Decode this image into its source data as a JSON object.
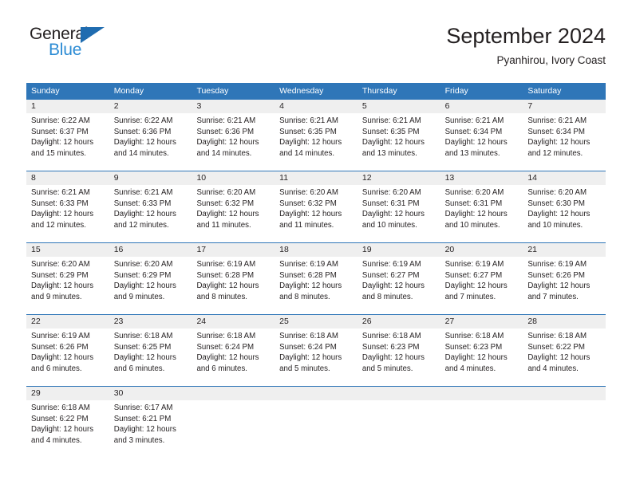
{
  "brand": {
    "name_top": "General",
    "name_bottom": "Blue",
    "accent_color": "#2b8bd4",
    "triangle_color": "#1f6cb0"
  },
  "header": {
    "title": "September 2024",
    "subtitle": "Pyanhirou, Ivory Coast"
  },
  "theme": {
    "header_blue": "#2f76b8",
    "daynum_band": "#efefef",
    "text": "#231f20"
  },
  "weekdays": [
    "Sunday",
    "Monday",
    "Tuesday",
    "Wednesday",
    "Thursday",
    "Friday",
    "Saturday"
  ],
  "weeks": [
    [
      {
        "day": "1",
        "sunrise": "Sunrise: 6:22 AM",
        "sunset": "Sunset: 6:37 PM",
        "daylight1": "Daylight: 12 hours",
        "daylight2": "and 15 minutes."
      },
      {
        "day": "2",
        "sunrise": "Sunrise: 6:22 AM",
        "sunset": "Sunset: 6:36 PM",
        "daylight1": "Daylight: 12 hours",
        "daylight2": "and 14 minutes."
      },
      {
        "day": "3",
        "sunrise": "Sunrise: 6:21 AM",
        "sunset": "Sunset: 6:36 PM",
        "daylight1": "Daylight: 12 hours",
        "daylight2": "and 14 minutes."
      },
      {
        "day": "4",
        "sunrise": "Sunrise: 6:21 AM",
        "sunset": "Sunset: 6:35 PM",
        "daylight1": "Daylight: 12 hours",
        "daylight2": "and 14 minutes."
      },
      {
        "day": "5",
        "sunrise": "Sunrise: 6:21 AM",
        "sunset": "Sunset: 6:35 PM",
        "daylight1": "Daylight: 12 hours",
        "daylight2": "and 13 minutes."
      },
      {
        "day": "6",
        "sunrise": "Sunrise: 6:21 AM",
        "sunset": "Sunset: 6:34 PM",
        "daylight1": "Daylight: 12 hours",
        "daylight2": "and 13 minutes."
      },
      {
        "day": "7",
        "sunrise": "Sunrise: 6:21 AM",
        "sunset": "Sunset: 6:34 PM",
        "daylight1": "Daylight: 12 hours",
        "daylight2": "and 12 minutes."
      }
    ],
    [
      {
        "day": "8",
        "sunrise": "Sunrise: 6:21 AM",
        "sunset": "Sunset: 6:33 PM",
        "daylight1": "Daylight: 12 hours",
        "daylight2": "and 12 minutes."
      },
      {
        "day": "9",
        "sunrise": "Sunrise: 6:21 AM",
        "sunset": "Sunset: 6:33 PM",
        "daylight1": "Daylight: 12 hours",
        "daylight2": "and 12 minutes."
      },
      {
        "day": "10",
        "sunrise": "Sunrise: 6:20 AM",
        "sunset": "Sunset: 6:32 PM",
        "daylight1": "Daylight: 12 hours",
        "daylight2": "and 11 minutes."
      },
      {
        "day": "11",
        "sunrise": "Sunrise: 6:20 AM",
        "sunset": "Sunset: 6:32 PM",
        "daylight1": "Daylight: 12 hours",
        "daylight2": "and 11 minutes."
      },
      {
        "day": "12",
        "sunrise": "Sunrise: 6:20 AM",
        "sunset": "Sunset: 6:31 PM",
        "daylight1": "Daylight: 12 hours",
        "daylight2": "and 10 minutes."
      },
      {
        "day": "13",
        "sunrise": "Sunrise: 6:20 AM",
        "sunset": "Sunset: 6:31 PM",
        "daylight1": "Daylight: 12 hours",
        "daylight2": "and 10 minutes."
      },
      {
        "day": "14",
        "sunrise": "Sunrise: 6:20 AM",
        "sunset": "Sunset: 6:30 PM",
        "daylight1": "Daylight: 12 hours",
        "daylight2": "and 10 minutes."
      }
    ],
    [
      {
        "day": "15",
        "sunrise": "Sunrise: 6:20 AM",
        "sunset": "Sunset: 6:29 PM",
        "daylight1": "Daylight: 12 hours",
        "daylight2": "and 9 minutes."
      },
      {
        "day": "16",
        "sunrise": "Sunrise: 6:20 AM",
        "sunset": "Sunset: 6:29 PM",
        "daylight1": "Daylight: 12 hours",
        "daylight2": "and 9 minutes."
      },
      {
        "day": "17",
        "sunrise": "Sunrise: 6:19 AM",
        "sunset": "Sunset: 6:28 PM",
        "daylight1": "Daylight: 12 hours",
        "daylight2": "and 8 minutes."
      },
      {
        "day": "18",
        "sunrise": "Sunrise: 6:19 AM",
        "sunset": "Sunset: 6:28 PM",
        "daylight1": "Daylight: 12 hours",
        "daylight2": "and 8 minutes."
      },
      {
        "day": "19",
        "sunrise": "Sunrise: 6:19 AM",
        "sunset": "Sunset: 6:27 PM",
        "daylight1": "Daylight: 12 hours",
        "daylight2": "and 8 minutes."
      },
      {
        "day": "20",
        "sunrise": "Sunrise: 6:19 AM",
        "sunset": "Sunset: 6:27 PM",
        "daylight1": "Daylight: 12 hours",
        "daylight2": "and 7 minutes."
      },
      {
        "day": "21",
        "sunrise": "Sunrise: 6:19 AM",
        "sunset": "Sunset: 6:26 PM",
        "daylight1": "Daylight: 12 hours",
        "daylight2": "and 7 minutes."
      }
    ],
    [
      {
        "day": "22",
        "sunrise": "Sunrise: 6:19 AM",
        "sunset": "Sunset: 6:26 PM",
        "daylight1": "Daylight: 12 hours",
        "daylight2": "and 6 minutes."
      },
      {
        "day": "23",
        "sunrise": "Sunrise: 6:18 AM",
        "sunset": "Sunset: 6:25 PM",
        "daylight1": "Daylight: 12 hours",
        "daylight2": "and 6 minutes."
      },
      {
        "day": "24",
        "sunrise": "Sunrise: 6:18 AM",
        "sunset": "Sunset: 6:24 PM",
        "daylight1": "Daylight: 12 hours",
        "daylight2": "and 6 minutes."
      },
      {
        "day": "25",
        "sunrise": "Sunrise: 6:18 AM",
        "sunset": "Sunset: 6:24 PM",
        "daylight1": "Daylight: 12 hours",
        "daylight2": "and 5 minutes."
      },
      {
        "day": "26",
        "sunrise": "Sunrise: 6:18 AM",
        "sunset": "Sunset: 6:23 PM",
        "daylight1": "Daylight: 12 hours",
        "daylight2": "and 5 minutes."
      },
      {
        "day": "27",
        "sunrise": "Sunrise: 6:18 AM",
        "sunset": "Sunset: 6:23 PM",
        "daylight1": "Daylight: 12 hours",
        "daylight2": "and 4 minutes."
      },
      {
        "day": "28",
        "sunrise": "Sunrise: 6:18 AM",
        "sunset": "Sunset: 6:22 PM",
        "daylight1": "Daylight: 12 hours",
        "daylight2": "and 4 minutes."
      }
    ],
    [
      {
        "day": "29",
        "sunrise": "Sunrise: 6:18 AM",
        "sunset": "Sunset: 6:22 PM",
        "daylight1": "Daylight: 12 hours",
        "daylight2": "and 4 minutes."
      },
      {
        "day": "30",
        "sunrise": "Sunrise: 6:17 AM",
        "sunset": "Sunset: 6:21 PM",
        "daylight1": "Daylight: 12 hours",
        "daylight2": "and 3 minutes."
      },
      {
        "day": "",
        "sunrise": "",
        "sunset": "",
        "daylight1": "",
        "daylight2": ""
      },
      {
        "day": "",
        "sunrise": "",
        "sunset": "",
        "daylight1": "",
        "daylight2": ""
      },
      {
        "day": "",
        "sunrise": "",
        "sunset": "",
        "daylight1": "",
        "daylight2": ""
      },
      {
        "day": "",
        "sunrise": "",
        "sunset": "",
        "daylight1": "",
        "daylight2": ""
      },
      {
        "day": "",
        "sunrise": "",
        "sunset": "",
        "daylight1": "",
        "daylight2": ""
      }
    ]
  ]
}
